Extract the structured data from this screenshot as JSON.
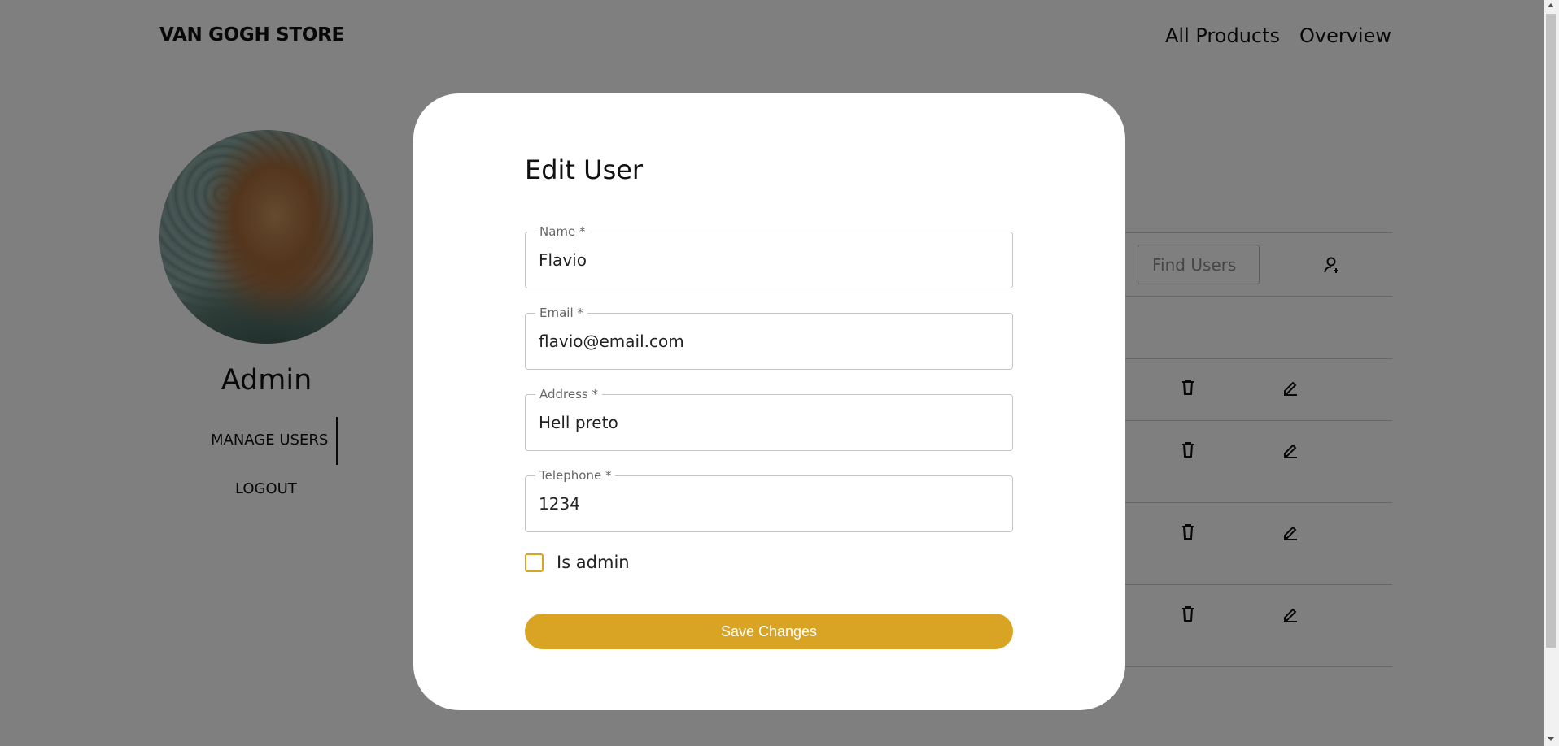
{
  "header": {
    "brand": "VAN GOGH STORE",
    "nav": [
      "All Products",
      "Overview"
    ]
  },
  "sidebar": {
    "avatar_alt": "avatar",
    "title": "Admin",
    "items": [
      "MANAGE USERS",
      "LOGOUT"
    ]
  },
  "users_panel": {
    "search_placeholder": "Find Users",
    "row_count": 4
  },
  "modal": {
    "title": "Edit User",
    "fields": [
      {
        "label": "Name *",
        "value": "Flavio"
      },
      {
        "label": "Email *",
        "value": "flavio@email.com"
      },
      {
        "label": "Address *",
        "value": "Hell preto"
      },
      {
        "label": "Telephone *",
        "value": "1234"
      }
    ],
    "checkbox_label": "Is admin",
    "is_admin": false,
    "submit_label": "Save Changes"
  },
  "colors": {
    "accent": "#d9a424",
    "overlay": "rgba(0,0,0,0.5)"
  }
}
